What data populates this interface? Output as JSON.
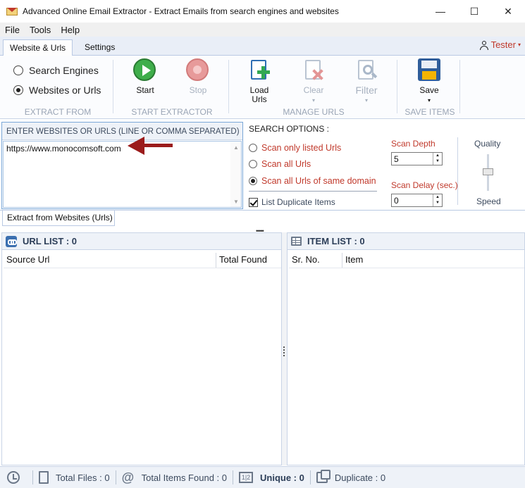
{
  "window": {
    "title": "Advanced Online Email Extractor - Extract Emails from search engines and websites",
    "minimize": "—",
    "maximize": "☐",
    "close": "✕"
  },
  "menu": [
    "File",
    "Tools",
    "Help"
  ],
  "ribbon_tabs": [
    "Website & Urls",
    "Settings"
  ],
  "user": {
    "name": "Tester",
    "caret": "▾"
  },
  "ribbon": {
    "extract_from": {
      "label": "EXTRACT FROM",
      "options": [
        "Search Engines",
        "Websites or Urls"
      ],
      "selected": "Websites or Urls"
    },
    "start_extractor": {
      "label": "START EXTRACTOR",
      "start": "Start",
      "stop": "Stop"
    },
    "manage_urls": {
      "label": "MANAGE URLS",
      "load": "Load Urls",
      "clear": "Clear",
      "filter": "Filter",
      "caret": "▾"
    },
    "save_items": {
      "label": "SAVE ITEMS",
      "save": "Save",
      "caret": "▾"
    }
  },
  "input_panel": {
    "header": "ENTER WEBSITES OR URLS (LINE OR COMMA SEPARATED)",
    "value": "https://www.monocomsoft.com",
    "scroll_up": "▲",
    "scroll_down": "▼",
    "tab": "Extract from Websites (Urls)"
  },
  "search_options": {
    "title": "SEARCH OPTIONS :",
    "options": [
      "Scan only listed Urls",
      "Scan all Urls",
      "Scan all Urls of same domain"
    ],
    "selected": "Scan all Urls of same domain",
    "list_duplicates": "List Duplicate Items",
    "list_duplicates_checked": true,
    "scan_depth_label": "Scan Depth",
    "scan_depth": "5",
    "scan_delay_label": "Scan Delay (sec.)",
    "scan_delay": "0",
    "quality": "Quality",
    "speed": "Speed",
    "spin_up": "▲",
    "spin_down": "▼"
  },
  "splitter_grip": "•••••",
  "url_list": {
    "title": "URL LIST : 0",
    "columns": [
      "Source Url",
      "Total Found"
    ]
  },
  "item_list": {
    "title": "ITEM LIST : 0",
    "columns": [
      "Sr. No.",
      "Item"
    ]
  },
  "status": {
    "total_files": "Total Files : 0",
    "total_items": "Total Items Found : 0",
    "unique": "Unique : 0",
    "duplicate": "Duplicate : 0",
    "unique_icon_text": "1|2"
  },
  "colors": {
    "accent_red": "#c0392b",
    "start_green": "#3fae4b",
    "arrow": "#9b1b1b",
    "ribbon_blue": "#e9eef7"
  }
}
